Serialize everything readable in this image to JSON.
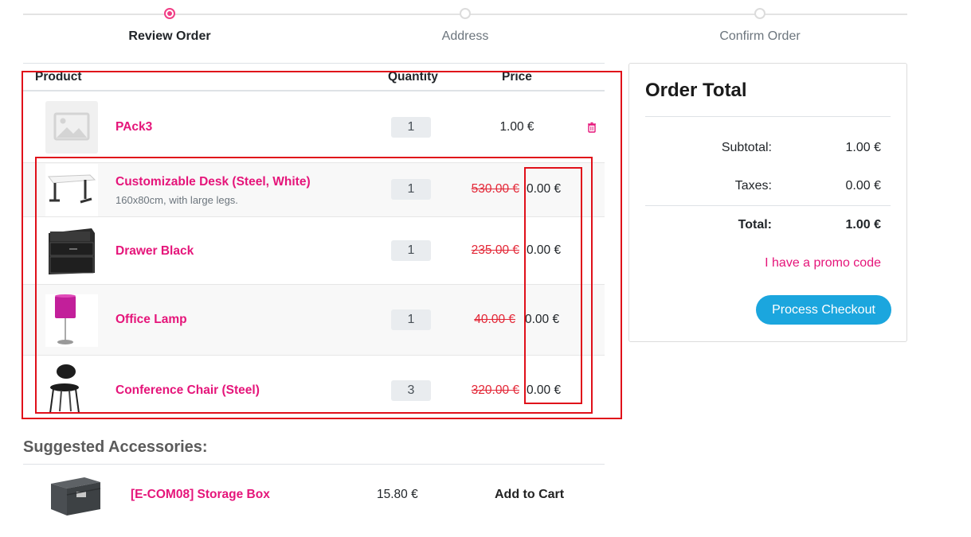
{
  "steps": {
    "items": [
      "Review Order",
      "Address",
      "Confirm Order"
    ],
    "active_index": 0
  },
  "cart": {
    "headers": {
      "product": "Product",
      "quantity": "Quantity",
      "price": "Price"
    },
    "rows": [
      {
        "name": "PAck3",
        "description": "",
        "quantity": "1",
        "old_price": "",
        "price": "1.00 €",
        "image": "placeholder-image-icon"
      },
      {
        "name": "Customizable Desk (Steel, White)",
        "description": "160x80cm, with large legs.",
        "quantity": "1",
        "old_price": "530.00 €",
        "price": "0.00 €",
        "image": "desk-image"
      },
      {
        "name": "Drawer Black",
        "description": "",
        "quantity": "1",
        "old_price": "235.00 €",
        "price": "0.00 €",
        "image": "drawer-image"
      },
      {
        "name": "Office Lamp",
        "description": "",
        "quantity": "1",
        "old_price": "40.00 €",
        "price": "0.00 €",
        "image": "lamp-image"
      },
      {
        "name": "Conference Chair (Steel)",
        "description": "",
        "quantity": "3",
        "old_price": "320.00 €",
        "price": "0.00 €",
        "image": "chair-image"
      }
    ]
  },
  "suggested": {
    "title": "Suggested Accessories:",
    "items": [
      {
        "name": "[E-COM08] Storage Box",
        "price": "15.80 €",
        "action": "Add to Cart",
        "image": "storage-box-image"
      }
    ]
  },
  "order_total": {
    "title": "Order Total",
    "subtotal_label": "Subtotal:",
    "subtotal_value": "1.00 €",
    "taxes_label": "Taxes:",
    "taxes_value": "0.00 €",
    "total_label": "Total:",
    "total_value": "1.00 €",
    "promo_link": "I have a promo code",
    "checkout_button": "Process Checkout"
  },
  "colors": {
    "accent": "#e5157a",
    "step_active": "#f13d85",
    "checkout": "#1ba6de",
    "strike_price": "#e32636",
    "annotation_box": "#e0101a"
  }
}
